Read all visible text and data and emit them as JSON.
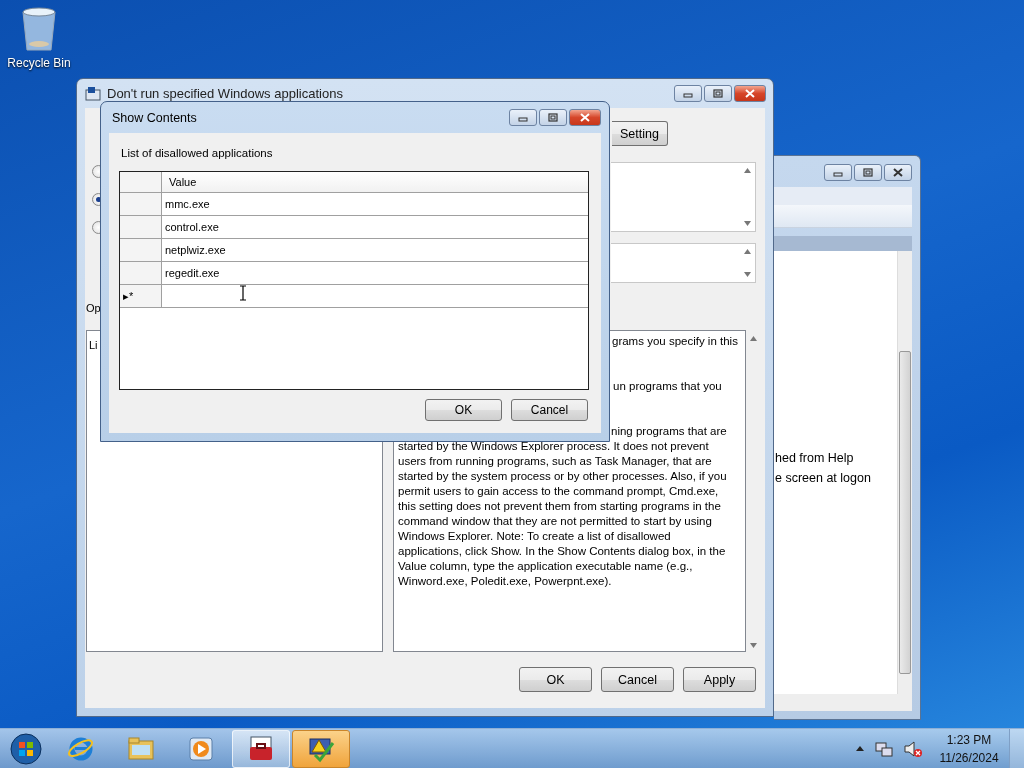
{
  "desktop_icons": [
    {
      "label": "Recycle Bin"
    }
  ],
  "back_window": {
    "lines": [
      "hed from Help",
      "e screen at logon"
    ]
  },
  "policy_window": {
    "title": "Don't run specified Windows applications",
    "setting_button": "Setting",
    "radios": [
      {
        "selected": false
      },
      {
        "selected": true
      },
      {
        "selected": false
      }
    ],
    "options_label": "Op",
    "options_text": "Li",
    "help_lines": [
      "grams you specify in this",
      "un programs that you",
      "ning programs that are",
      "started by the Windows Explorer process. It does not prevent",
      "users from running programs, such as Task Manager, that are",
      "started by the system process or by other processes. Also, if you",
      "permit users to gain access to the command prompt, Cmd.exe,",
      "this setting does not prevent them from starting programs in the",
      "command window that they are not permitted to start by using",
      "Windows Explorer. Note: To create a list of disallowed",
      "applications, click Show. In the Show Contents dialog box, in the",
      "Value column, type the application executable name (e.g.,",
      "Winword.exe, Poledit.exe, Powerpnt.exe)."
    ],
    "buttons": [
      "OK",
      "Cancel",
      "Apply"
    ]
  },
  "dialog": {
    "title": "Show Contents",
    "label": "List of disallowed applications",
    "column": "Value",
    "rows": [
      "mmc.exe",
      "control.exe",
      "netplwiz.exe",
      "regedit.exe"
    ],
    "new_row_marker": "▸*",
    "buttons": [
      "OK",
      "Cancel"
    ]
  },
  "taskbar": {
    "apps": [
      {
        "kind": "browser",
        "running": false,
        "flashing": false
      },
      {
        "kind": "folder",
        "running": false,
        "flashing": false
      },
      {
        "kind": "media",
        "running": false,
        "flashing": false
      },
      {
        "kind": "toolbox",
        "running": true,
        "flashing": false
      },
      {
        "kind": "warning",
        "running": true,
        "flashing": true
      }
    ],
    "clock": {
      "time": "1:23 PM",
      "date": "11/26/2024"
    }
  }
}
